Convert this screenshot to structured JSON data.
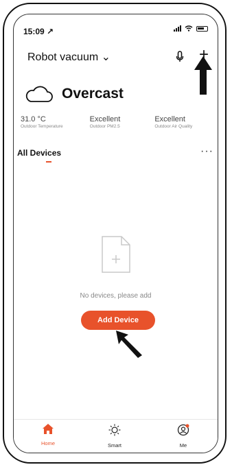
{
  "status_bar": {
    "time": "15:09 ↗"
  },
  "header": {
    "home_name": "Robot vacuum ⌄"
  },
  "weather": {
    "condition": "Overcast"
  },
  "stats": [
    {
      "value": "31.0 °C",
      "label": "Outdoor Temperature"
    },
    {
      "value": "Excellent",
      "label": "Outdoor PM2.5"
    },
    {
      "value": "Excellent",
      "label": "Outdoor Air Quality"
    }
  ],
  "tabs": {
    "all_devices": "All Devices",
    "more": "···"
  },
  "empty": {
    "message": "No devices, please add",
    "button": "Add Device"
  },
  "tabbar": {
    "home": "Home",
    "smart": "Smart",
    "me": "Me"
  },
  "colors": {
    "accent": "#e8522b"
  }
}
